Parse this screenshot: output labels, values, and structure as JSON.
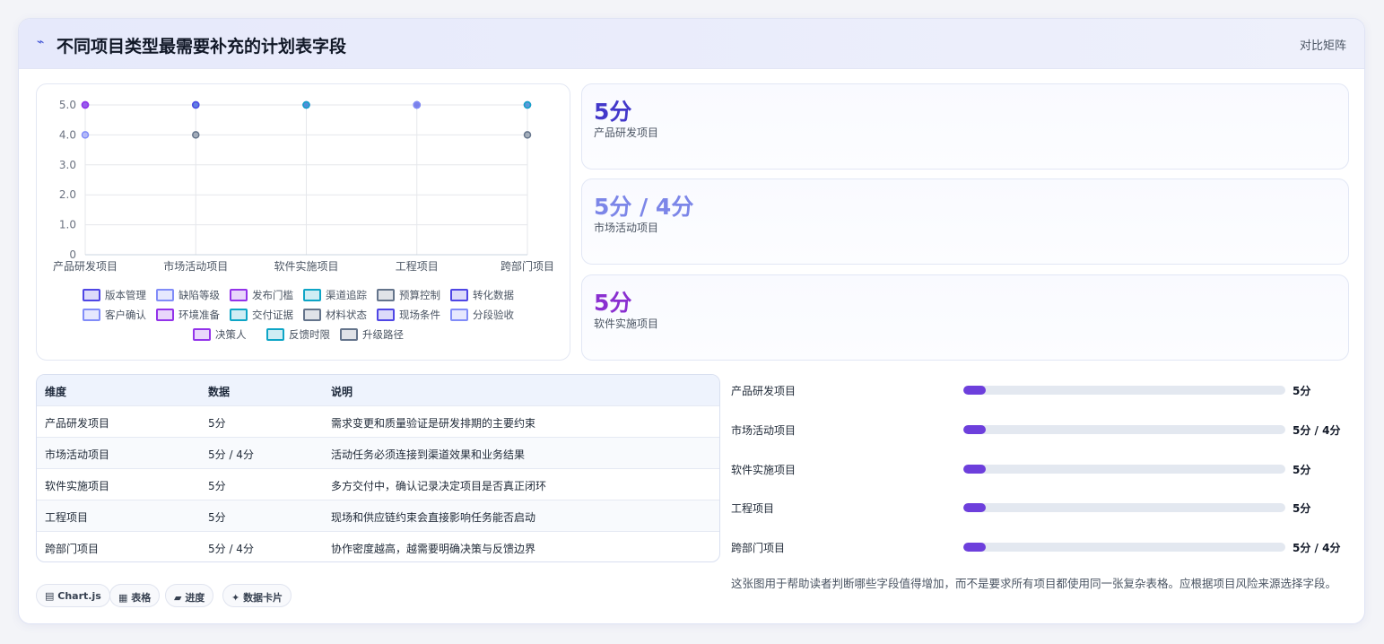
{
  "header": {
    "icon": "bolt-icon",
    "title": "不同项目类型最需要补充的计划表字段",
    "matrix_btn": "对比矩阵"
  },
  "colors": {
    "indigo": "#4f46e5",
    "periwinkle": "#818cf8",
    "violet": "#9333ea",
    "cyan": "#0ea5c6",
    "slate": "#64748b",
    "accent": "#6d3fdc"
  },
  "chart_data": {
    "type": "scatter",
    "categories": [
      "产品研发项目",
      "市场活动项目",
      "软件实施项目",
      "工程项目",
      "跨部门项目"
    ],
    "ylim": [
      0,
      5
    ],
    "yticks": [
      0,
      1,
      2,
      3,
      4,
      5
    ],
    "ytick_labels": [
      "0",
      "1.0",
      "2.0",
      "3.0",
      "4.0",
      "5.0"
    ],
    "grid": true,
    "legend_position": "bottom",
    "series": [
      {
        "name": "版本管理",
        "color": "#4f46e5",
        "values": [
          5,
          null,
          null,
          null,
          null
        ]
      },
      {
        "name": "缺陷等级",
        "color": "#818cf8",
        "values": [
          4,
          null,
          null,
          null,
          null
        ]
      },
      {
        "name": "发布门槛",
        "color": "#9333ea",
        "values": [
          5,
          null,
          null,
          null,
          null
        ]
      },
      {
        "name": "渠道追踪",
        "color": "#0ea5c6",
        "values": [
          null,
          5,
          null,
          null,
          null
        ]
      },
      {
        "name": "预算控制",
        "color": "#64748b",
        "values": [
          null,
          4,
          null,
          null,
          null
        ]
      },
      {
        "name": "转化数据",
        "color": "#4f46e5",
        "values": [
          null,
          5,
          null,
          null,
          null
        ]
      },
      {
        "name": "客户确认",
        "color": "#818cf8",
        "values": [
          null,
          null,
          5,
          null,
          null
        ]
      },
      {
        "name": "环境准备",
        "color": "#9333ea",
        "values": [
          null,
          null,
          5,
          null,
          null
        ]
      },
      {
        "name": "交付证据",
        "color": "#0ea5c6",
        "values": [
          null,
          null,
          5,
          null,
          null
        ]
      },
      {
        "name": "材料状态",
        "color": "#64748b",
        "values": [
          null,
          null,
          null,
          5,
          null
        ]
      },
      {
        "name": "现场条件",
        "color": "#4f46e5",
        "values": [
          null,
          null,
          null,
          5,
          null
        ]
      },
      {
        "name": "分段验收",
        "color": "#818cf8",
        "values": [
          null,
          null,
          null,
          5,
          null
        ]
      },
      {
        "name": "决策人",
        "color": "#9333ea",
        "values": [
          null,
          null,
          null,
          null,
          5
        ]
      },
      {
        "name": "反馈时限",
        "color": "#0ea5c6",
        "values": [
          null,
          null,
          null,
          null,
          5
        ]
      },
      {
        "name": "升级路径",
        "color": "#64748b",
        "values": [
          null,
          null,
          null,
          null,
          4
        ]
      }
    ]
  },
  "stats": [
    {
      "value": "5分",
      "label": "产品研发项目",
      "color": "#4338ca"
    },
    {
      "value": "5分 / 4分",
      "label": "市场活动项目",
      "color": "#7c86e8"
    },
    {
      "value": "5分",
      "label": "软件实施项目",
      "color": "#8a2fd0"
    }
  ],
  "table": {
    "headers": [
      "维度",
      "数据",
      "说明"
    ],
    "rows": [
      [
        "产品研发项目",
        "5分",
        "需求变更和质量验证是研发排期的主要约束"
      ],
      [
        "市场活动项目",
        "5分 / 4分",
        "活动任务必须连接到渠道效果和业务结果"
      ],
      [
        "软件实施项目",
        "5分",
        "多方交付中，确认记录决定项目是否真正闭环"
      ],
      [
        "工程项目",
        "5分",
        "现场和供应链约束会直接影响任务能否启动"
      ],
      [
        "跨部门项目",
        "5分 / 4分",
        "协作密度越高，越需要明确决策与反馈边界"
      ]
    ]
  },
  "progress": [
    {
      "label": "产品研发项目",
      "value": "5分",
      "fill": 0.07
    },
    {
      "label": "市场活动项目",
      "value": "5分 / 4分",
      "fill": 0.07
    },
    {
      "label": "软件实施项目",
      "value": "5分",
      "fill": 0.07
    },
    {
      "label": "工程项目",
      "value": "5分",
      "fill": 0.07
    },
    {
      "label": "跨部门项目",
      "value": "5分 / 4分",
      "fill": 0.07
    }
  ],
  "note": "这张图用于帮助读者判断哪些字段值得增加，而不是要求所有项目都使用同一张复杂表格。应根据项目风险来源选择字段。",
  "chips": [
    {
      "icon": "chart-icon",
      "glyph": "▤",
      "label": "Chart.js"
    },
    {
      "icon": "table-icon",
      "glyph": "▦",
      "label": "表格"
    },
    {
      "icon": "progress-icon",
      "glyph": "▰",
      "label": "进度"
    },
    {
      "icon": "sparkle-icon",
      "glyph": "✦",
      "label": "数据卡片"
    }
  ]
}
